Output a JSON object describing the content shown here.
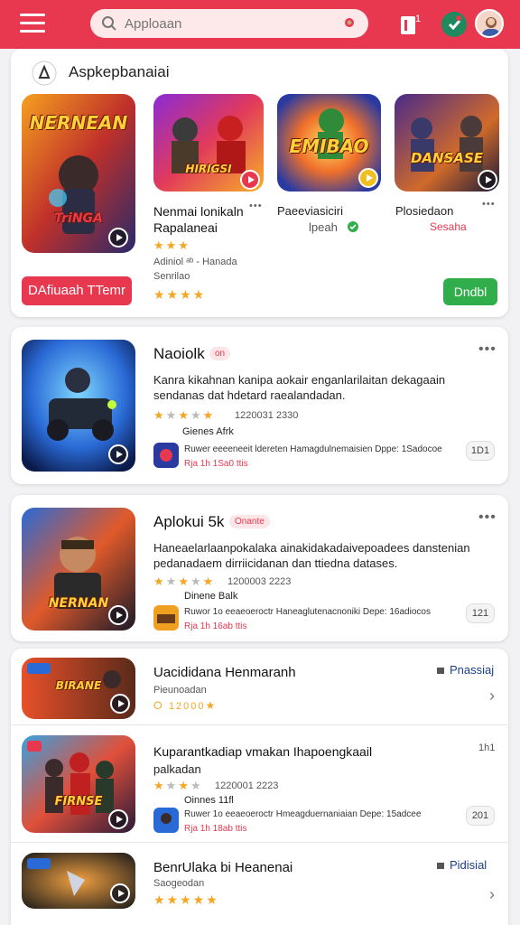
{
  "search": {
    "placeholder": "Apploaan"
  },
  "header": {
    "badge_count": "1"
  },
  "featured": {
    "title": "Aspkepbanaiai",
    "apps": [
      {
        "art_text": "NERNEAN",
        "art_sub": "TriNGA",
        "name": "",
        "sub": "",
        "stars": "★★★",
        "line2": "",
        "btn": "DAfiuaah TTemr"
      },
      {
        "art_text": "HIRIGSI",
        "name": "Nenmai lonikaln",
        "name2": "Rapalaneai",
        "stars": "★★★",
        "meta1": "Adiniol ᵃᵇ - Hanada",
        "meta2": "Senrilao",
        "stars2": "★★★★"
      },
      {
        "art_text": "EMIBAO",
        "name": "Paeeviasiciri",
        "sub": "lpeah"
      },
      {
        "art_text": "DANSASE",
        "name": "Plosiedaon",
        "sub": "Sesaha",
        "btn": "Dndbl"
      }
    ]
  },
  "items": [
    {
      "title": "Naoiolk",
      "badge": "on",
      "desc": "Kanra kikahnan kanipa aokair enganlarilaitan dekagaain sendanas dat hdetard raealandadan.",
      "rating": "1220031 2330",
      "dev": "Gienes Afrk",
      "review_line": "Ruwer eeeeneeit ldereten Hamagdulnemaisien Dppe: 1Sadocoe",
      "review_meta": "Rja 1h 1Sa0 ttis",
      "pill": "1D1"
    },
    {
      "title": "Aplokui 5k",
      "badge": "Onante",
      "desc": "Haneaelarlaanpokalaka ainakidakadaivepoadees danstenian pedanadaem dirriicidanan dan ttiedna datases.",
      "rating": "1200003 2223",
      "dev": "Dinene Balk",
      "review_line": "Ruwor 1o eeaeoeroctr Haneaglutenacnoniki Depe: 16adiocos",
      "review_meta": "Rja 1h 16ab ttis",
      "pill": "121"
    },
    {
      "title": "Uacididana Henmaranh",
      "sub": "Pieunoadan",
      "rating": "12000",
      "tag": "Pnassiaj",
      "art_text": "BIRANE"
    },
    {
      "title": "Kuparantkadiap vmakan Ihapoengkaail",
      "sub": "palkadan",
      "rating": "1220001 2223",
      "dev": "Oinnes 11fl",
      "review_line": "Ruwer 1o eeaeoeroctr Hmeagduernaniaian Depe: 15adcee",
      "review_meta": "Rja 1h 18ab ttis",
      "pill": "201",
      "tag": "1h1",
      "art_text": "FIRNSE"
    },
    {
      "title": "BenrUlaka bi Heanenai",
      "sub": "Saogeodan",
      "tag": "Pidisial"
    }
  ]
}
